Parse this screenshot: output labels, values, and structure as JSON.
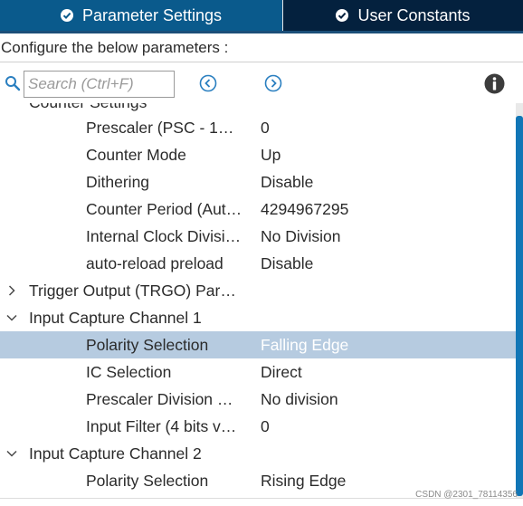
{
  "tabs": {
    "parameter_settings": "Parameter Settings",
    "user_constants": "User Constants"
  },
  "description": "Configure the below parameters :",
  "search": {
    "placeholder": "Search (Ctrl+F)"
  },
  "tree": {
    "cut_header": "Counter Settings",
    "rows": [
      {
        "label": "Prescaler (PSC - 1…",
        "value": "0"
      },
      {
        "label": "Counter Mode",
        "value": "Up"
      },
      {
        "label": "Dithering",
        "value": "Disable"
      },
      {
        "label": "Counter Period (Aut…",
        "value": "4294967295"
      },
      {
        "label": "Internal Clock Divisi…",
        "value": "No Division"
      },
      {
        "label": "auto-reload preload",
        "value": "Disable"
      }
    ],
    "trigger_group": "Trigger Output (TRGO) Par…",
    "ic1_group": "Input Capture Channel 1",
    "ic1_rows": [
      {
        "label": "Polarity Selection",
        "value": "Falling Edge"
      },
      {
        "label": "IC Selection",
        "value": "Direct"
      },
      {
        "label": "Prescaler Division …",
        "value": "No division"
      },
      {
        "label": "Input Filter (4 bits v…",
        "value": "0"
      }
    ],
    "ic2_group": "Input Capture Channel 2",
    "ic2_rows": [
      {
        "label": "Polarity Selection",
        "value": "Rising Edge"
      }
    ]
  },
  "watermark": "CSDN @2301_78114356",
  "colors": {
    "active_tab": "#0a5a8c",
    "inactive_tab": "#04213e",
    "selection": "#b6cbe0",
    "scrollbar": "#1176b6",
    "search_icon": "#2a7fc0"
  }
}
